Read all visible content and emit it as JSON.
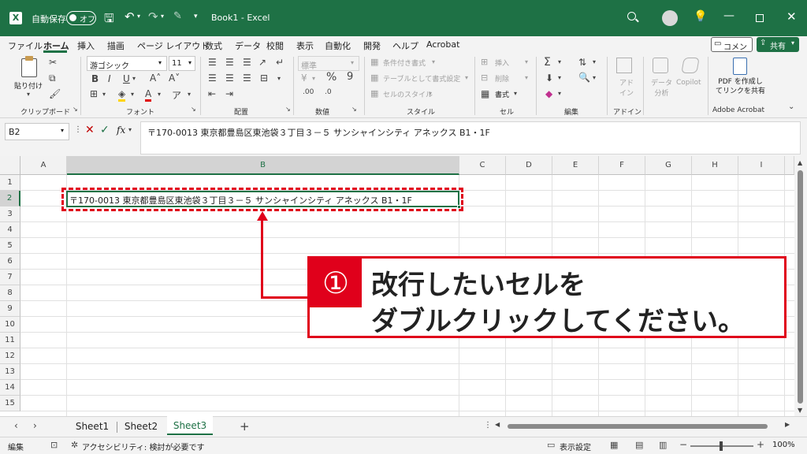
{
  "titlebar": {
    "autosave_label": "自動保存",
    "toggle_state": "オフ",
    "doc_title": "Book1 - Excel"
  },
  "menu": {
    "items": [
      "ファイル",
      "ホーム",
      "挿入",
      "描画",
      "ページ レイアウト",
      "数式",
      "データ",
      "校閲",
      "表示",
      "自動化",
      "開発",
      "ヘルプ",
      "Acrobat"
    ],
    "comment": "コメント",
    "share": "共有"
  },
  "ribbon": {
    "clipboard": {
      "paste": "貼り付け",
      "label": "クリップボード"
    },
    "font": {
      "name": "游ゴシック",
      "size": "11",
      "label": "フォント"
    },
    "alignment": {
      "label": "配置"
    },
    "number": {
      "format": "標準",
      "label": "数値"
    },
    "styles": {
      "conditional": "条件付き書式",
      "table": "テーブルとして書式設定",
      "cell": "セルのスタイル",
      "label": "スタイル"
    },
    "cells": {
      "insert": "挿入",
      "delete": "削除",
      "format": "書式",
      "label": "セル"
    },
    "editing": {
      "label": "編集"
    },
    "addins": {
      "addin": "アド\nイン",
      "label": "アドイン"
    },
    "ai": {
      "data_analysis": "データ\n分析",
      "copilot": "Copilot"
    },
    "acrobat": {
      "create": "PDF を作成し\nてリンクを共有",
      "label": "Adobe Acrobat"
    }
  },
  "formula_bar": {
    "name_box": "B2",
    "fx": "fx",
    "content": "〒170-0013 東京都豊島区東池袋３丁目３－５ サンシャインシティ アネックス B1・1F"
  },
  "grid": {
    "columns": [
      "A",
      "B",
      "C",
      "D",
      "E",
      "F",
      "G",
      "H",
      "I"
    ],
    "rows": [
      "1",
      "2",
      "3",
      "4",
      "5",
      "6",
      "7",
      "8",
      "9",
      "10",
      "11",
      "12",
      "13",
      "14",
      "15"
    ],
    "cell_b2": "〒170-0013 東京都豊島区東池袋３丁目３－５ サンシャインシティ アネックス B1・1F"
  },
  "callout": {
    "number": "①",
    "line1": "改行したいセルを",
    "line2": "ダブルクリックしてください。"
  },
  "sheets": {
    "tabs": [
      "Sheet1",
      "Sheet2",
      "Sheet3"
    ],
    "active": "Sheet3",
    "add": "+"
  },
  "status": {
    "mode": "編集",
    "accessibility": "アクセシビリティ: 検討が必要です",
    "display": "表示設定",
    "zoom": "100%"
  },
  "colors": {
    "excel_green": "#1e7145",
    "callout_red": "#e0001b"
  }
}
